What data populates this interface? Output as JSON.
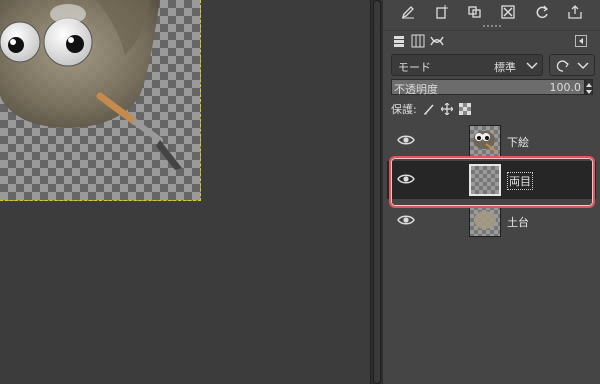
{
  "dock": {
    "toolbar": {
      "icons": [
        "edit-icon",
        "new-layer-icon",
        "duplicate-icon",
        "delete-icon",
        "refresh-icon",
        "export-icon"
      ]
    },
    "tabs": [
      "layers-tab-icon",
      "channels-tab-icon",
      "paths-tab-icon"
    ],
    "mode": {
      "label": "モード",
      "value": "標準"
    },
    "opacity": {
      "label": "不透明度",
      "value": "100.0",
      "fraction": 1.0
    },
    "lock": {
      "label": "保護:"
    },
    "layers": [
      {
        "name": "下絵",
        "visible": true,
        "selected": false
      },
      {
        "name": "両目",
        "visible": true,
        "selected": true
      },
      {
        "name": "土台",
        "visible": true,
        "selected": false
      }
    ]
  },
  "colors": {
    "selection_outline": "#e0555e",
    "selection_bg": "#262626",
    "canvas_boundary": "#e3d000"
  }
}
